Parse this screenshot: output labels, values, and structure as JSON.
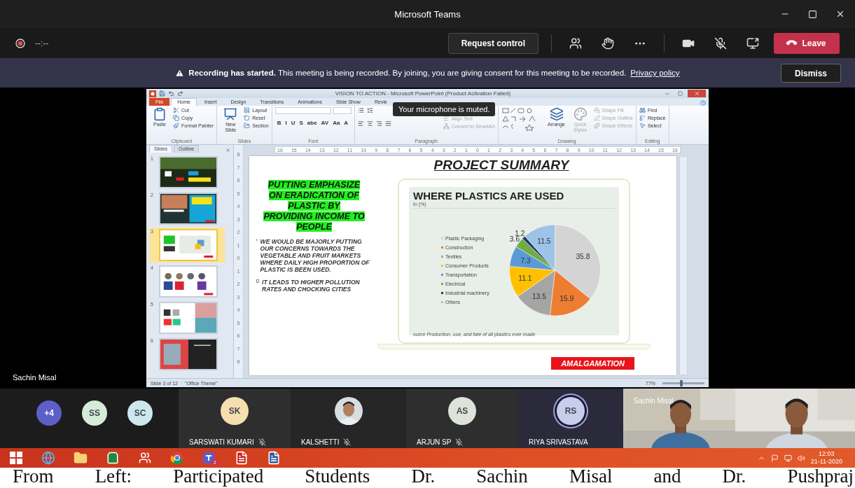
{
  "window": {
    "title": "Microsoft Teams"
  },
  "meeting_bar": {
    "recording": true,
    "timer": "--:--",
    "request_control": "Request control",
    "mic_muted": true,
    "leave": "Leave"
  },
  "banner": {
    "message": "**Recording has started.** This meeting is being recorded. By joining, you are giving consent for this meeting to be recorded.",
    "link": "Privacy policy",
    "dismiss": "Dismiss"
  },
  "shared_screen": {
    "presenter": "Sachin Misal",
    "powerpoint": {
      "title": "VISION  TO ACTION - Microsoft PowerPoint (Product Activation Failed)",
      "tabs": [
        {
          "label": "File",
          "kind": "file",
          "selected": false
        },
        {
          "label": "Home",
          "kind": "tab",
          "selected": true
        },
        {
          "label": "Insert",
          "kind": "tab",
          "selected": false
        },
        {
          "label": "Design",
          "kind": "tab",
          "selected": false
        },
        {
          "label": "Transitions",
          "kind": "tab",
          "selected": false
        },
        {
          "label": "Animations",
          "kind": "tab",
          "selected": false
        },
        {
          "label": "Slide Show",
          "kind": "tab",
          "selected": false
        },
        {
          "label": "Revie",
          "kind": "tab",
          "selected": false
        }
      ],
      "tooltip": "Your microphone is muted.",
      "ribbon": [
        {
          "label": "Clipboard",
          "kind": "buttons",
          "large": [
            {
              "label": "Paste",
              "kind": "paste",
              "disabled": false
            }
          ],
          "small": [
            {
              "label": "Cut",
              "kind": "cut",
              "disabled": false
            },
            {
              "label": "Copy",
              "kind": "copy",
              "disabled": false
            },
            {
              "label": "Format Painter",
              "kind": "painter",
              "disabled": false
            }
          ]
        },
        {
          "label": "Slides",
          "kind": "buttons",
          "large": [
            {
              "label": "New Slide",
              "kind": "new_slide",
              "disabled": false
            }
          ],
          "small": [
            {
              "label": "Layout",
              "kind": "layout",
              "disabled": false
            },
            {
              "label": "Reset",
              "kind": "reset",
              "disabled": false
            },
            {
              "label": "Section",
              "kind": "section",
              "disabled": false
            }
          ]
        },
        {
          "label": "Font",
          "kind": "font",
          "glyphs": [
            "B",
            "I",
            "U",
            "S",
            "abe",
            "AV",
            "Aa",
            "A"
          ]
        },
        {
          "label": "Paragraph",
          "kind": "paragraph",
          "small": [
            {
              "label": "Align Text",
              "kind": "align",
              "disabled": true
            },
            {
              "label": "Convert to SmartArt",
              "kind": "smartart",
              "disabled": true
            }
          ]
        },
        {
          "label": "Drawing",
          "kind": "drawing",
          "large": [
            {
              "label": "Arrange",
              "kind": "arrange",
              "disabled": false
            },
            {
              "label": "Quick Styles",
              "kind": "styles",
              "disabled": true
            }
          ],
          "small": [
            {
              "label": "Shape Fill",
              "kind": "fill",
              "disabled": true
            },
            {
              "label": "Shape Outline",
              "kind": "outline",
              "disabled": true
            },
            {
              "label": "Shape Effects",
              "kind": "effects",
              "disabled": true
            }
          ]
        },
        {
          "label": "Editing",
          "kind": "buttons",
          "small": [
            {
              "label": "Find",
              "kind": "find",
              "disabled": false
            },
            {
              "label": "Replace",
              "kind": "replace",
              "disabled": false
            },
            {
              "label": "Select",
              "kind": "select",
              "disabled": false
            }
          ]
        }
      ],
      "panel_tabs": [
        {
          "label": "Slides",
          "selected": true
        },
        {
          "label": "Outline",
          "selected": false
        }
      ],
      "thumbnails": [
        {
          "number": "1",
          "selected": false
        },
        {
          "number": "2",
          "selected": false
        },
        {
          "number": "3",
          "selected": true
        },
        {
          "number": "4",
          "selected": false
        },
        {
          "number": "5",
          "selected": false
        },
        {
          "number": "6",
          "selected": false
        }
      ],
      "ruler_h": [
        "16",
        "15",
        "14",
        "13",
        "12",
        "11",
        "10",
        "9",
        "8",
        "7",
        "6",
        "5",
        "4",
        "3",
        "2",
        "1",
        "0",
        "1",
        "2",
        "3",
        "4",
        "5",
        "6",
        "7",
        "8",
        "9",
        "10",
        "11",
        "12",
        "13",
        "14",
        "15",
        "16"
      ],
      "ruler_v": [
        "8",
        "7",
        "6",
        "5",
        "4",
        "3",
        "2",
        "1",
        "0",
        "1",
        "2",
        "3",
        "4",
        "5",
        "6",
        "7",
        "8"
      ],
      "slide": {
        "title": "PROJECT SUMMARY",
        "highlight": "PUTTING EMPHASIZE ON ERADICATION OF PLASTIC BY PROVIDING INCOME TO PEOPLE",
        "bullets": [
          "WE WOULD BE MAJORLY PUTTING OUR CONCERNS TOWARDS THE VEGETABLE AND FRUIT MARKETS WHERE DAILY HIGH PROPORTION OF PLASTIC IS BEEN USED.",
          "IT LEADS TO HIGHER POLLUTION RATES AND CHOCKING CITIES"
        ],
        "chart": {
          "title": "WHERE PLASTICS ARE USED",
          "unit": "In (%)",
          "legend": [
            {
              "color": "#d4d4d4"
            },
            {
              "color": "#ed7d31"
            },
            {
              "color": "#a5a5a5"
            },
            {
              "color": "#ffc000"
            },
            {
              "color": "#5b9bd5"
            },
            {
              "color": "#70ad47"
            },
            {
              "color": "#1f3864"
            },
            {
              "color": "#9dc3e6"
            }
          ],
          "chart_data": {
            "type": "pie",
            "categories": [
              "Plastic Packaging",
              "Construction",
              "Textiles",
              "Consumer Products",
              "Transportation",
              "Electrical",
              "Industrial machinery",
              "Others"
            ],
            "values": [
              35.8,
              15.9,
              13.5,
              11.1,
              7.3,
              3.6,
              1.2,
              11.5
            ],
            "data_labels": true
          },
          "source": "ource Production, use, and fate of all plastics ever made"
        },
        "badge": "AMALGAMATION"
      },
      "status": {
        "slide_count": "Slide 3 of 12",
        "theme": "\"Office Theme\"",
        "zoom": "77%",
        "zoom_slider": {
          "level": 0.45
        }
      }
    }
  },
  "roster": [
    {
      "initials": "+4",
      "kind": "overflow",
      "color": "#5b5fc7"
    },
    {
      "initials": "SS",
      "kind": "avatar",
      "color": "#d5ecd8"
    },
    {
      "initials": "SC",
      "kind": "avatar",
      "color": "#cde8ec"
    }
  ],
  "tiles": [
    {
      "kind": "initials",
      "initials": "SK",
      "name": "SARSWATI KUMARI",
      "color": "#f5dfb0",
      "muted": true,
      "speaking": false
    },
    {
      "name": "KALSHETTI",
      "muted": true,
      "speaking": false
    },
    {
      "kind": "initials",
      "initials": "AS",
      "name": "ARJUN SP",
      "color": "#dde3d8",
      "muted": true,
      "speaking": false
    },
    {
      "kind": "initials",
      "initials": "RS",
      "name": "RIYA SRIVASTAVA",
      "color": "#c8cdee",
      "muted": false,
      "speaking": true
    },
    {
      "kind": "video",
      "name": "Sachin Misal"
    },
    {
      "kind": "video"
    }
  ],
  "taskbar": {
    "apps": [
      {
        "kind": "browser"
      },
      {
        "kind": "files"
      },
      {
        "kind": "store"
      },
      {
        "kind": "people"
      },
      {
        "kind": "chrome"
      },
      {
        "kind": "teams",
        "badge": "2"
      },
      {
        "kind": "pdf"
      },
      {
        "kind": "word"
      }
    ],
    "time": "12:03",
    "date": "21-11-2020"
  },
  "caption": "From Left: Participated Students Dr. Sachin Misal and Dr. Pushpraj"
}
